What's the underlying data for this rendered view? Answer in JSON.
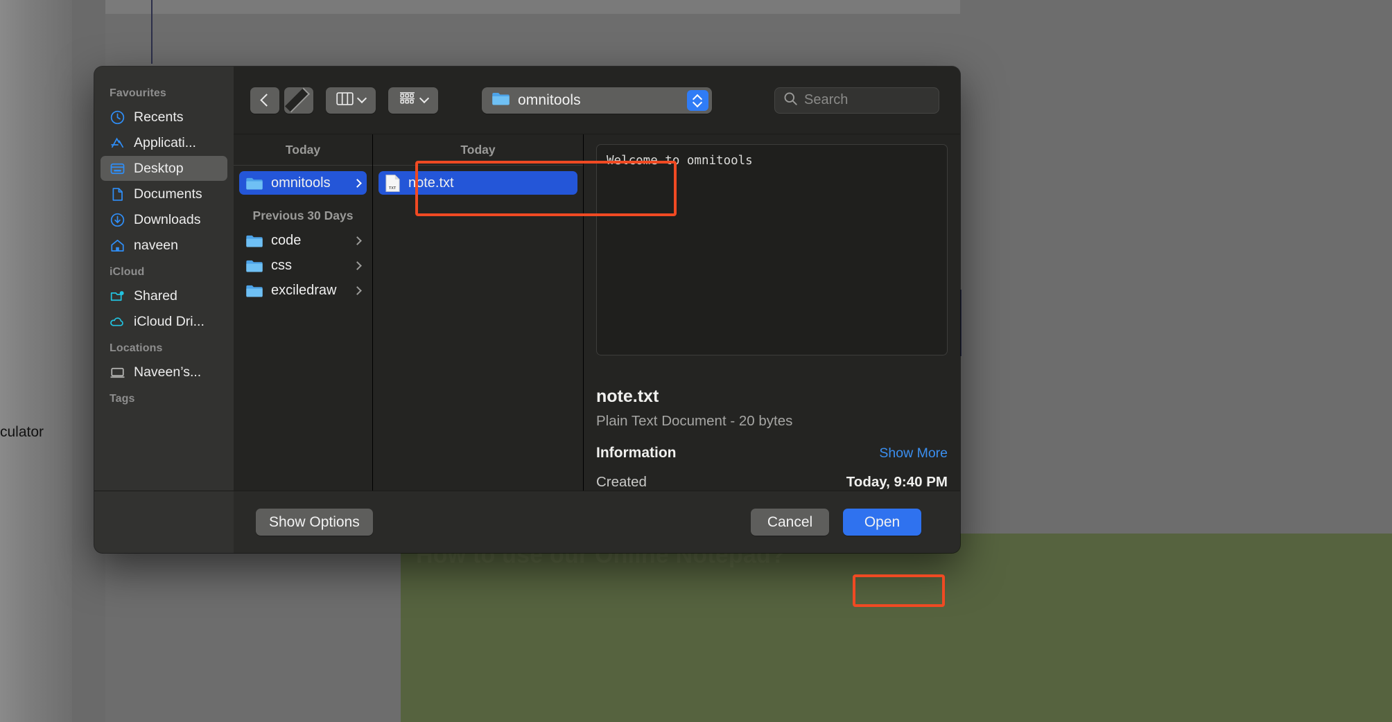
{
  "background": {
    "label_calculator": "culator",
    "heading_partial": "How to use our Online Notepad?"
  },
  "dialog": {
    "sidebar": {
      "sections": [
        {
          "title": "Favourites",
          "items": [
            {
              "label": "Recents",
              "icon": "clock-icon",
              "selected": false
            },
            {
              "label": "Applicati...",
              "icon": "applications-icon",
              "selected": false
            },
            {
              "label": "Desktop",
              "icon": "desktop-icon",
              "selected": true
            },
            {
              "label": "Documents",
              "icon": "document-icon",
              "selected": false
            },
            {
              "label": "Downloads",
              "icon": "downloads-icon",
              "selected": false
            },
            {
              "label": "naveen",
              "icon": "home-icon",
              "selected": false
            }
          ]
        },
        {
          "title": "iCloud",
          "items": [
            {
              "label": "Shared",
              "icon": "shared-folder-icon",
              "selected": false
            },
            {
              "label": "iCloud Dri...",
              "icon": "cloud-icon",
              "selected": false
            }
          ]
        },
        {
          "title": "Locations",
          "items": [
            {
              "label": "Naveen’s...",
              "icon": "laptop-icon",
              "selected": false
            }
          ]
        },
        {
          "title": "Tags",
          "items": []
        }
      ]
    },
    "toolbar": {
      "back_icon": "chevron-left-icon",
      "forward_icon": "chevron-right-icon",
      "view_icon": "column-view-icon",
      "view_chevron": "chevron-down-icon",
      "group_icon": "group-by-icon",
      "group_chevron": "chevron-down-icon",
      "path_label": "omnitools",
      "path_icon": "folder-icon",
      "stepper_icon": "stepper-updown-icon",
      "search_placeholder": "Search",
      "search_value": "",
      "search_icon": "search-icon"
    },
    "columns": [
      {
        "header": "Today",
        "groups": [
          {
            "title": "",
            "items": [
              {
                "label": "omnitools",
                "icon": "folder-icon",
                "selected": true,
                "disclosure": true
              }
            ]
          },
          {
            "title": "Previous 30 Days",
            "items": [
              {
                "label": "code",
                "icon": "folder-icon",
                "selected": false,
                "disclosure": true
              },
              {
                "label": "css",
                "icon": "folder-icon",
                "selected": false,
                "disclosure": true
              },
              {
                "label": "exciledraw",
                "icon": "folder-icon",
                "selected": false,
                "disclosure": true
              }
            ]
          }
        ]
      },
      {
        "header": "Today",
        "groups": [
          {
            "title": "",
            "items": [
              {
                "label": "note.txt",
                "icon": "txt-file-icon",
                "selected": true,
                "disclosure": false
              }
            ]
          }
        ]
      }
    ],
    "preview": {
      "text_content": "Welcome to omnitools",
      "file_name": "note.txt",
      "file_kind": "Plain Text Document - 20 bytes",
      "information_title": "Information",
      "show_more_label": "Show More",
      "created_key": "Created",
      "created_value": "Today, 9:40 PM"
    },
    "bottom": {
      "show_options_label": "Show Options",
      "cancel_label": "Cancel",
      "open_label": "Open"
    }
  },
  "annotations": {
    "accent_color": "#f04a23",
    "targets": [
      "note-txt-row",
      "open-button"
    ]
  },
  "colors": {
    "selection_blue": "#2456d8",
    "primary_button_blue": "#2f72ef",
    "sidebar_bg": "#323230",
    "dialog_bg": "#242422",
    "link_blue": "#3b8ff0"
  }
}
